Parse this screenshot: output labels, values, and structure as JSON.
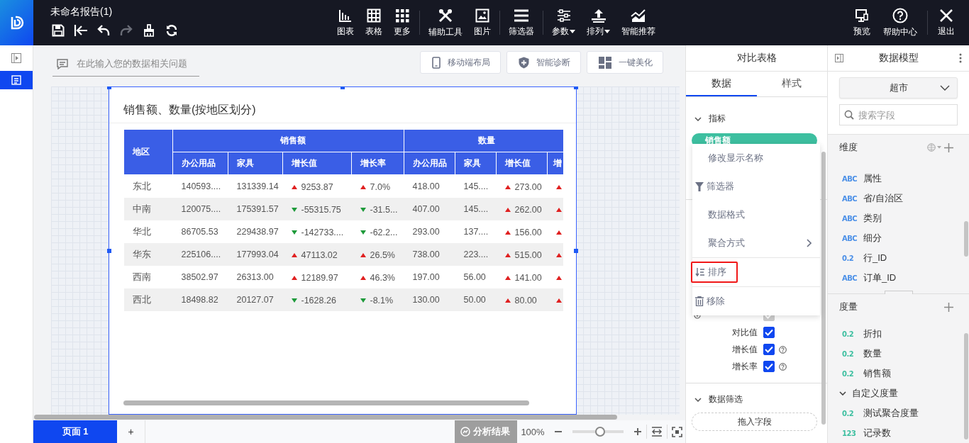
{
  "app": {
    "title": "未命名报告(1)"
  },
  "file_actions": [
    {
      "disabled": false
    },
    {
      "disabled": false
    },
    {
      "disabled": false
    },
    {
      "disabled": true
    },
    {
      "disabled": false
    },
    {
      "disabled": false
    }
  ],
  "toolbar": [
    [
      {
        "label": "图表",
        "caret": false
      },
      {
        "label": "表格",
        "caret": false
      },
      {
        "label": "更多",
        "caret": false
      }
    ],
    [
      {
        "label": "辅助工具",
        "caret": false
      },
      {
        "label": "图片",
        "caret": false
      }
    ],
    [
      {
        "label": "筛选器",
        "caret": false
      }
    ],
    [
      {
        "label": "参数",
        "caret": true
      },
      {
        "label": "排列",
        "caret": true
      },
      {
        "label": "智能推荐",
        "caret": false
      }
    ]
  ],
  "right_actions": [
    [
      {
        "label": "预览"
      },
      {
        "label": "帮助中心"
      }
    ],
    [
      {
        "label": "退出"
      }
    ]
  ],
  "side_strip": [
    {
      "selected": false
    },
    {
      "selected": true
    }
  ],
  "question": {
    "placeholder": "在此输入您的数据相关问题"
  },
  "canvas_buttons": [
    "移动端布局",
    "智能诊断",
    "一键美化"
  ],
  "chart": {
    "title": "销售额、数量(按地区划分)",
    "row_header": "地区",
    "groups": [
      {
        "label": "销售额",
        "columns": [
          "办公用品",
          "家具",
          "增长值",
          "增长率"
        ]
      },
      {
        "label": "数量",
        "columns": [
          "办公用品",
          "家具",
          "增长值",
          "增"
        ]
      }
    ],
    "rows": [
      {
        "region": "东北",
        "cells": [
          {
            "text": "140593...."
          },
          {
            "text": "131339.14"
          },
          {
            "text": "9253.87",
            "kind": "up"
          },
          {
            "text": "7.0%",
            "kind": "up"
          },
          {
            "text": "418.00"
          },
          {
            "text": "145...."
          },
          {
            "text": "273.00",
            "kind": "up"
          },
          {
            "kind": "up"
          }
        ]
      },
      {
        "region": "中南",
        "cells": [
          {
            "text": "120075...."
          },
          {
            "text": "175391.57"
          },
          {
            "text": "-55315.75",
            "kind": "down"
          },
          {
            "text": "-31.5...",
            "kind": "down"
          },
          {
            "text": "407.00"
          },
          {
            "text": "145...."
          },
          {
            "text": "262.00",
            "kind": "up"
          },
          {
            "kind": "up"
          }
        ]
      },
      {
        "region": "华北",
        "cells": [
          {
            "text": "86705.53"
          },
          {
            "text": "229438.97"
          },
          {
            "text": "-142733....",
            "kind": "down"
          },
          {
            "text": "-62.2...",
            "kind": "down"
          },
          {
            "text": "293.00"
          },
          {
            "text": "137...."
          },
          {
            "text": "156.00",
            "kind": "up"
          },
          {
            "kind": "up"
          }
        ]
      },
      {
        "region": "华东",
        "cells": [
          {
            "text": "225106...."
          },
          {
            "text": "177993.04"
          },
          {
            "text": "47113.02",
            "kind": "up"
          },
          {
            "text": "26.5%",
            "kind": "up"
          },
          {
            "text": "738.00"
          },
          {
            "text": "223...."
          },
          {
            "text": "515.00",
            "kind": "up"
          },
          {
            "kind": "up"
          }
        ]
      },
      {
        "region": "西南",
        "cells": [
          {
            "text": "38502.97"
          },
          {
            "text": "26313.00"
          },
          {
            "text": "12189.97",
            "kind": "up"
          },
          {
            "text": "46.3%",
            "kind": "up"
          },
          {
            "text": "197.00"
          },
          {
            "text": "56.00"
          },
          {
            "text": "141.00",
            "kind": "up"
          },
          {
            "kind": "up"
          }
        ]
      },
      {
        "region": "西北",
        "cells": [
          {
            "text": "18498.82"
          },
          {
            "text": "20127.07"
          },
          {
            "text": "-1628.26",
            "kind": "down"
          },
          {
            "text": "-8.1%",
            "kind": "down"
          },
          {
            "text": "130.00"
          },
          {
            "text": "50.00"
          },
          {
            "text": "80.00",
            "kind": "up"
          },
          {
            "kind": "up"
          }
        ]
      }
    ]
  },
  "properties": {
    "title": "对比表格",
    "tabs": [
      {
        "label": "数据",
        "selected": true
      },
      {
        "label": "样式",
        "selected": false
      }
    ],
    "metrics": {
      "label": "指标",
      "expanded": true,
      "chip": "销售额"
    },
    "context_menu": [
      {
        "label": "修改显示名称",
        "kind": "plain",
        "highlighted": false
      },
      {
        "label": "筛选器",
        "kind": "filter",
        "highlighted": false
      },
      {
        "label": "数据格式",
        "kind": "plain",
        "highlighted": false
      },
      {
        "label": "聚合方式",
        "kind": "submenu",
        "highlighted": false
      },
      {
        "label": "排序",
        "kind": "sort",
        "highlighted": true
      },
      {
        "label": "移除",
        "kind": "remove",
        "highlighted": false
      }
    ],
    "display": {
      "options": [
        {
          "checked": true,
          "disabled": true,
          "help": false
        },
        {
          "label": "对比值",
          "checked": true,
          "disabled": false,
          "help": false
        },
        {
          "label": "增长值",
          "checked": true,
          "disabled": false,
          "help": true
        },
        {
          "label": "增长率",
          "checked": true,
          "disabled": false,
          "help": true
        }
      ]
    },
    "filter": {
      "label": "数据筛选",
      "expanded": true,
      "drop": "拖入字段"
    }
  },
  "model": {
    "title": "数据模型",
    "source": "超市",
    "search_placeholder": "搜索字段",
    "dimensions": {
      "label": "维度",
      "fields": [
        {
          "badge": "ABC",
          "name": "属性",
          "color": "#4a8fe7"
        },
        {
          "badge": "ABC",
          "name": "省/自治区",
          "color": "#4a8fe7"
        },
        {
          "badge": "ABC",
          "name": "类别",
          "color": "#4a8fe7"
        },
        {
          "badge": "ABC",
          "name": "细分",
          "color": "#4a8fe7"
        },
        {
          "badge": "0.2",
          "name": "行_ID",
          "color": "#4a8fe7"
        },
        {
          "badge": "ABC",
          "name": "订单_ID",
          "color": "#4a8fe7"
        }
      ]
    },
    "measures": {
      "label": "度量",
      "fields": [
        {
          "kind": "field",
          "badge": "0.2",
          "name": "折扣",
          "color": "#3dbfa0"
        },
        {
          "kind": "field",
          "badge": "0.2",
          "name": "数量",
          "color": "#3dbfa0"
        },
        {
          "kind": "field",
          "badge": "0.2",
          "name": "销售额",
          "color": "#3dbfa0"
        },
        {
          "kind": "group",
          "name": "自定义度量",
          "expanded": true,
          "children": [
            {
              "kind": "field",
              "badge": "0.2",
              "name": "测试聚合度量",
              "color": "#3dbfa0"
            },
            {
              "kind": "field",
              "badge": "123",
              "name": "记录数",
              "color": "#3dbfa0"
            }
          ]
        }
      ]
    }
  },
  "footer": {
    "pages": [
      {
        "label": "页面 1",
        "selected": true
      }
    ],
    "add_page": "+",
    "analysis": "分析结果",
    "zoom": {
      "reading": "100%",
      "level": 0.54
    }
  }
}
